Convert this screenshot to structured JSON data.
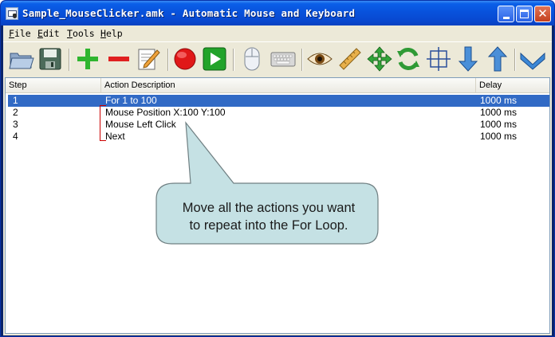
{
  "window": {
    "title": "Sample_MouseClicker.amk - Automatic Mouse and Keyboard"
  },
  "menu": [
    {
      "label": "File",
      "key": "F",
      "rest": "ile"
    },
    {
      "label": "Edit",
      "key": "E",
      "rest": "dit"
    },
    {
      "label": "Tools",
      "key": "T",
      "rest": "ools"
    },
    {
      "label": "Help",
      "key": "H",
      "rest": "elp"
    }
  ],
  "toolbar": {
    "icons": [
      "open-folder-icon",
      "save-icon",
      "add-icon",
      "remove-icon",
      "edit-icon",
      "record-icon",
      "play-icon",
      "mouse-icon",
      "keyboard-icon",
      "eye-icon",
      "ruler-icon",
      "move-icon",
      "refresh-icon",
      "crosshair-icon",
      "move-down-icon",
      "move-up-icon",
      "collapse-icon"
    ]
  },
  "table": {
    "columns": [
      "Step",
      "Action Description",
      "Delay"
    ],
    "rows": [
      {
        "step": "1",
        "description": "For 1 to 100",
        "delay": "1000 ms",
        "selected": true
      },
      {
        "step": "2",
        "description": "Mouse Position X:100 Y:100",
        "delay": "1000 ms",
        "selected": false
      },
      {
        "step": "3",
        "description": "Mouse Left Click",
        "delay": "1000 ms",
        "selected": false
      },
      {
        "step": "4",
        "description": "Next",
        "delay": "1000 ms",
        "selected": false
      }
    ]
  },
  "callout": {
    "line1": "Move all the actions you want",
    "line2": "to repeat into the For Loop.",
    "fill": "#c5e1e4",
    "stroke": "#6f7f82"
  },
  "colors": {
    "selection": "#316ac5",
    "bracket": "#cc0000",
    "record": "#e01818",
    "play": "#22a32a",
    "add": "#2fb52f",
    "remove": "#e02020",
    "arrow": "#4a8fd8"
  }
}
